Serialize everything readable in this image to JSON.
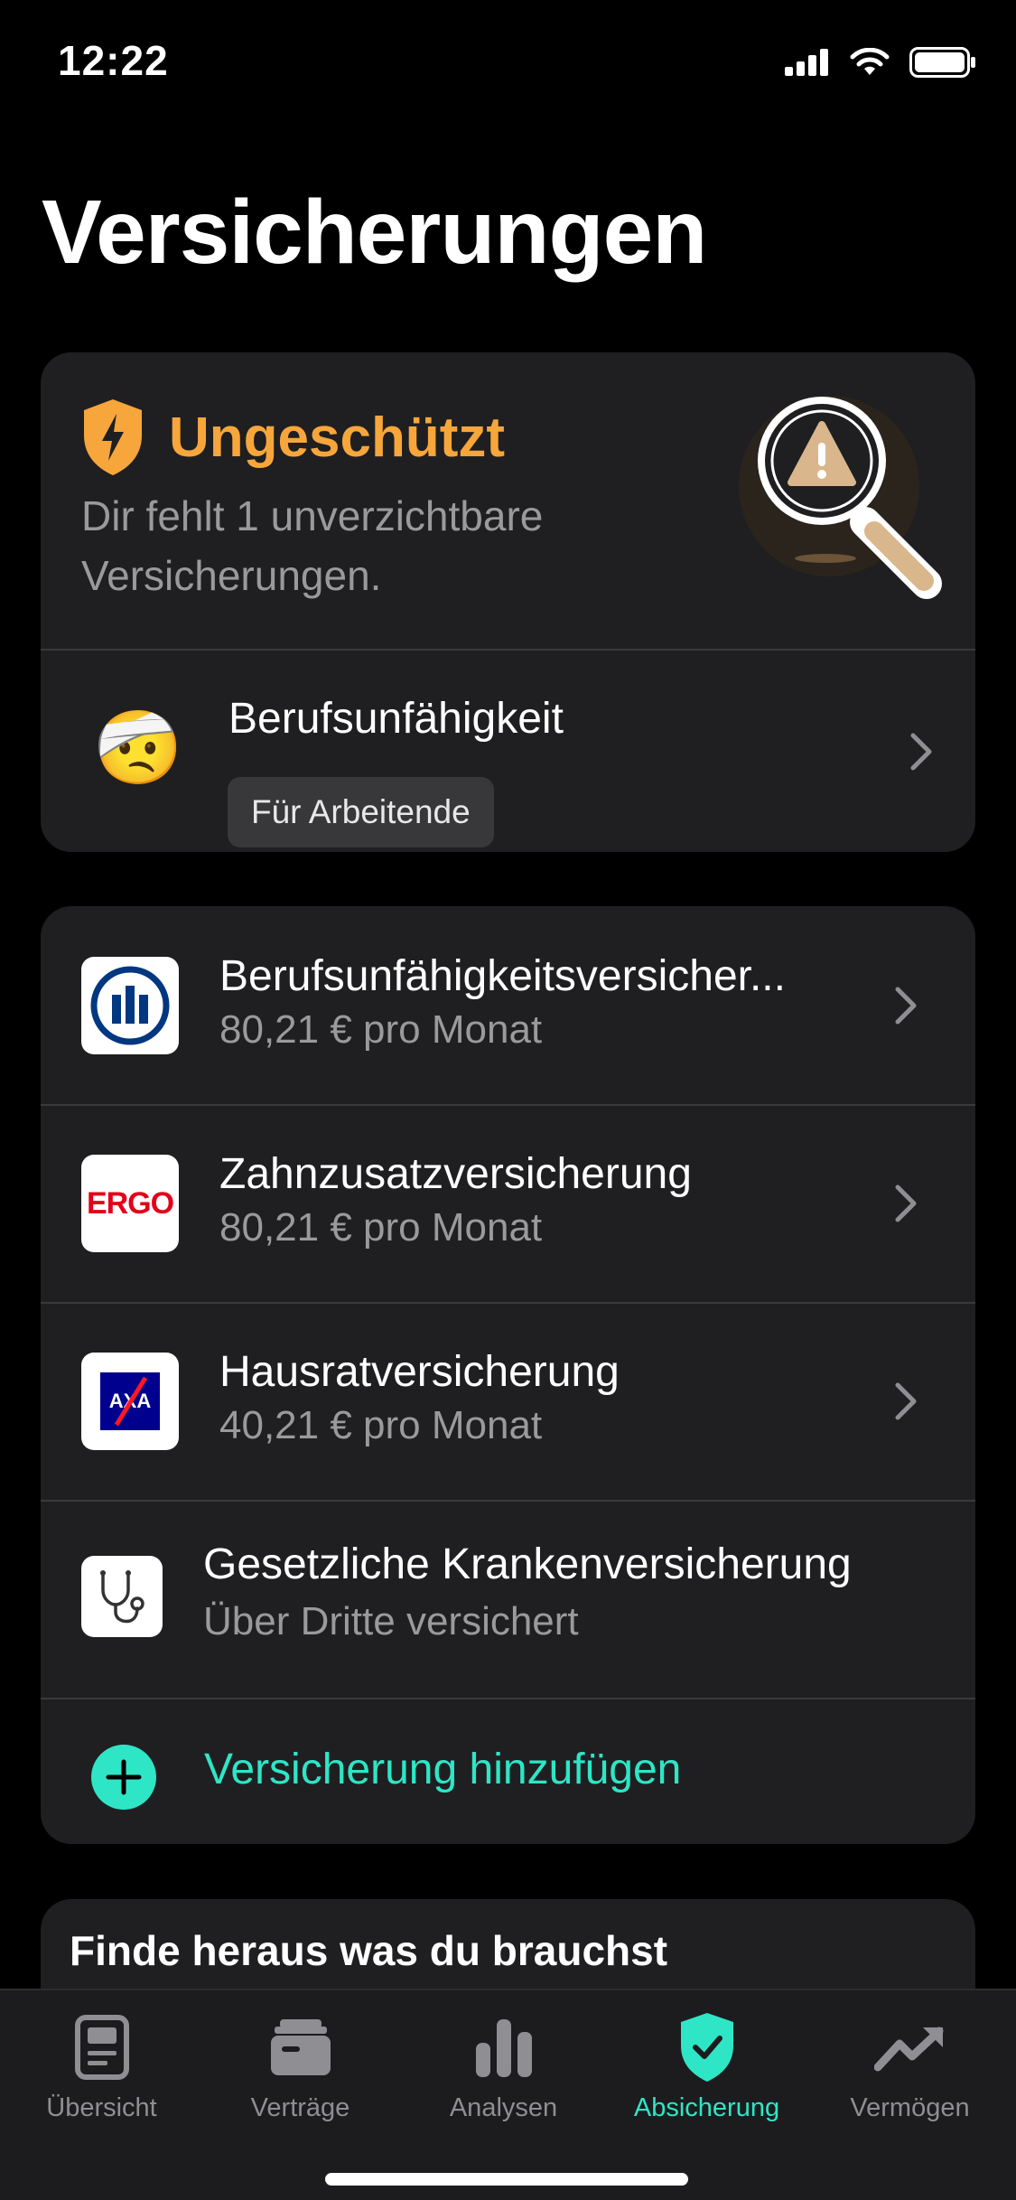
{
  "status_bar": {
    "time": "12:22"
  },
  "page": {
    "title": "Versicherungen"
  },
  "alert": {
    "status": "Ungeschützt",
    "description": "Dir fehlt 1 unverzichtbare Versicherungen.",
    "missing_item": {
      "title": "Berufsunfähigkeit",
      "badge": "Für Arbeitende",
      "emoji": "🤕"
    }
  },
  "insurances": [
    {
      "name": "Berufsunfähigkeitsversicher...",
      "price": "80,21 € pro Monat",
      "logo": "allianz-logo"
    },
    {
      "name": "Zahnzusatzversicherung",
      "price": "80,21 € pro Monat",
      "logo": "ergo-logo",
      "logo_text": "ERGO"
    },
    {
      "name": "Hausratversicherung",
      "price": "40,21 € pro Monat",
      "logo": "axa-logo",
      "logo_text": "AXA"
    },
    {
      "name": "Gesetzliche Krankenversicherung",
      "price": "Über Dritte versichert",
      "logo": "stethoscope-icon"
    }
  ],
  "add_insurance": {
    "label": "Versicherung hinzufügen"
  },
  "find_section": {
    "title": "Finde heraus was du brauchst"
  },
  "tab_bar": {
    "tabs": [
      {
        "label": "Übersicht",
        "icon": "overview-icon",
        "active": false
      },
      {
        "label": "Verträge",
        "icon": "contracts-icon",
        "active": false
      },
      {
        "label": "Analysen",
        "icon": "analytics-icon",
        "active": false
      },
      {
        "label": "Absicherung",
        "icon": "shield-check-icon",
        "active": true
      },
      {
        "label": "Vermögen",
        "icon": "trend-up-icon",
        "active": false
      }
    ]
  },
  "colors": {
    "background": "#000000",
    "card": "#1f1f21",
    "warning": "#f7a63b",
    "accent": "#2ee6c6",
    "muted_text": "#9a9a9c",
    "ergo_red": "#e2001a",
    "allianz_blue": "#003781",
    "axa_blue": "#00008f"
  }
}
